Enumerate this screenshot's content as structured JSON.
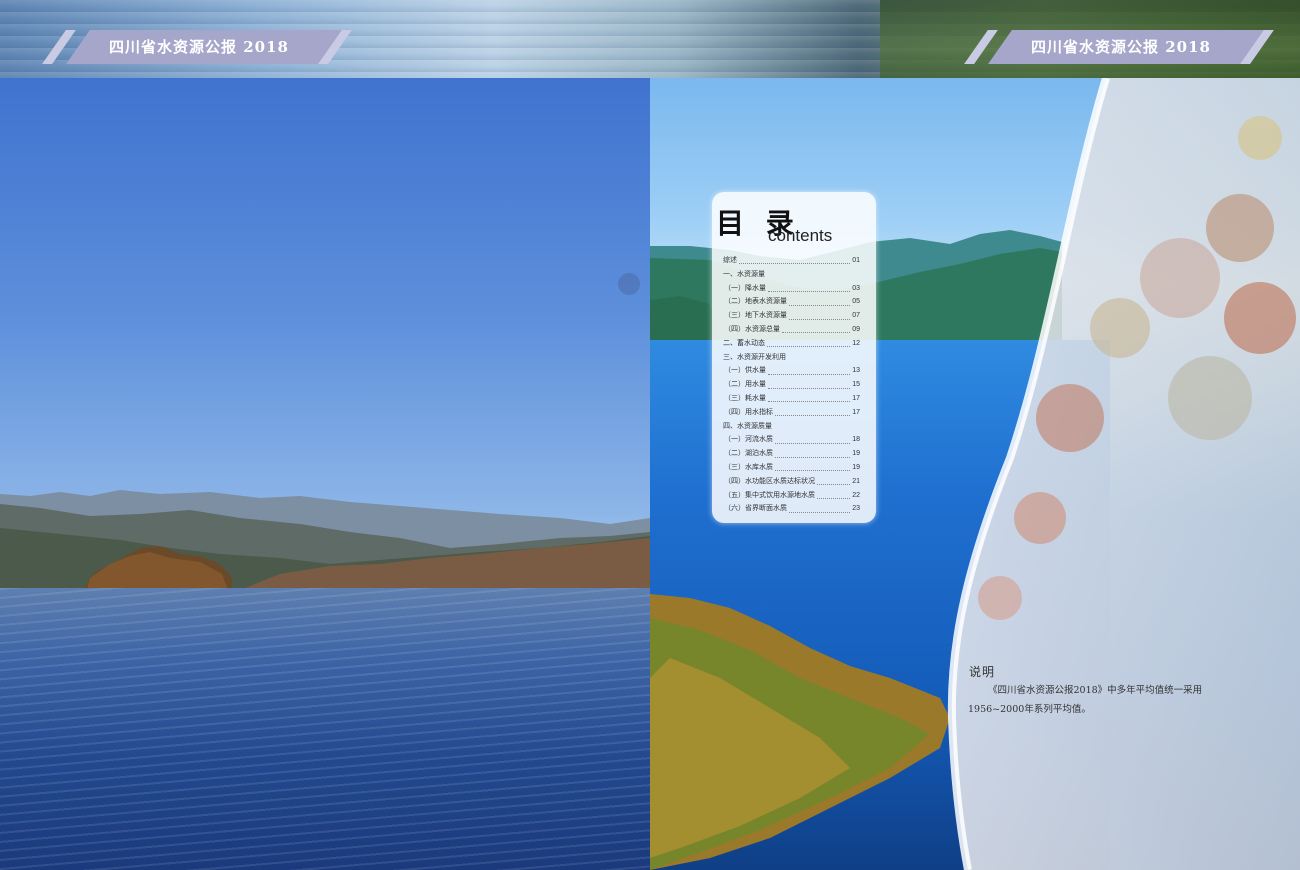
{
  "header": {
    "left_title": "四川省水资源公报 2018",
    "right_title": "四川省水资源公报 2018"
  },
  "colors": {
    "ribbon": "#a5a6c9",
    "ribbon_text": "#ffffff"
  },
  "toc": {
    "title": "目 录",
    "subtitle": "contents",
    "items": [
      {
        "label": "综述",
        "page": "01",
        "type": "entry"
      },
      {
        "label": "一、水资源量",
        "page": "",
        "type": "section"
      },
      {
        "label": "（一）降水量",
        "page": "03",
        "type": "entry"
      },
      {
        "label": "（二）地表水资源量",
        "page": "05",
        "type": "entry"
      },
      {
        "label": "（三）地下水资源量",
        "page": "07",
        "type": "entry"
      },
      {
        "label": "（四）水资源总量",
        "page": "09",
        "type": "entry"
      },
      {
        "label": "二、蓄水动态",
        "page": "12",
        "type": "entry"
      },
      {
        "label": "三、水资源开发利用",
        "page": "",
        "type": "section"
      },
      {
        "label": "（一）供水量",
        "page": "13",
        "type": "entry"
      },
      {
        "label": "（二）用水量",
        "page": "15",
        "type": "entry"
      },
      {
        "label": "（三）耗水量",
        "page": "17",
        "type": "entry"
      },
      {
        "label": "（四）用水指标",
        "page": "17",
        "type": "entry"
      },
      {
        "label": "四、水资源质量",
        "page": "",
        "type": "section"
      },
      {
        "label": "（一）河流水质",
        "page": "18",
        "type": "entry"
      },
      {
        "label": "（二）湖泊水质",
        "page": "19",
        "type": "entry"
      },
      {
        "label": "（三）水库水质",
        "page": "19",
        "type": "entry"
      },
      {
        "label": "（四）水功能区水质达标状况",
        "page": "21",
        "type": "entry"
      },
      {
        "label": "（五）集中式饮用水源地水质",
        "page": "22",
        "type": "entry"
      },
      {
        "label": "（六）省界断面水质",
        "page": "23",
        "type": "entry"
      }
    ]
  },
  "note": {
    "heading": "说明",
    "body": "《四川省水资源公报2018》中多年平均值统一采用1956~2000年系列平均值。"
  }
}
